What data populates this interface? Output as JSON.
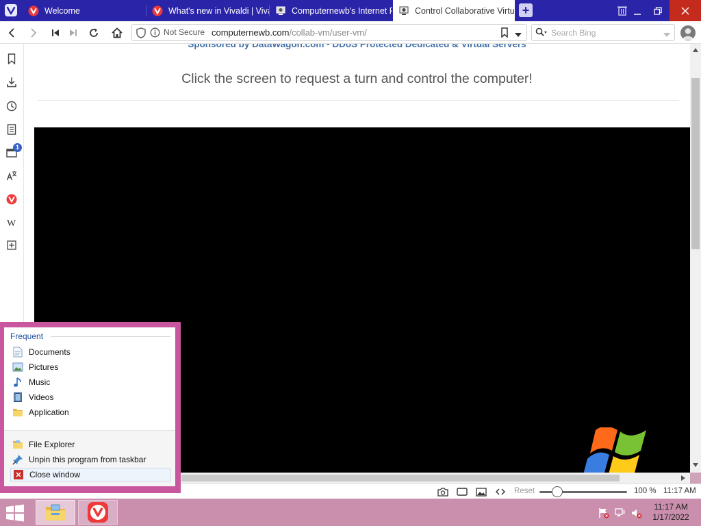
{
  "browser": {
    "tabs": [
      {
        "title": "Welcome",
        "icon": "vivaldi-icon",
        "active": false
      },
      {
        "title": "What's new in Vivaldi | Vival",
        "icon": "vivaldi-icon",
        "active": false
      },
      {
        "title": "Computernewb's Internet P",
        "icon": "computernewb-icon",
        "active": false
      },
      {
        "title": "Control Collaborative Virtu",
        "icon": "computernewb-icon",
        "active": true
      }
    ],
    "new_tab_label": "+",
    "address": {
      "security_label": "Not Secure",
      "host": "computernewb.com",
      "path": "/collab-vm/user-vm/"
    },
    "search": {
      "placeholder": "Search Bing"
    },
    "accent": "#2a24a8",
    "side_panel": {
      "downloads_badge": "1"
    }
  },
  "page": {
    "sponsor": "Sponsored by DataWagon.com - DDoS Protected Dedicated & Virtual Servers",
    "instruction": "Click the screen to request a turn and control the computer!"
  },
  "status_bar": {
    "reset_label": "Reset",
    "zoom": "100 %",
    "clock": "11:17 AM"
  },
  "jump_list": {
    "section_title": "Frequent",
    "frequent": [
      {
        "label": "Documents",
        "icon": "documents-icon"
      },
      {
        "label": "Pictures",
        "icon": "pictures-icon"
      },
      {
        "label": "Music",
        "icon": "music-icon"
      },
      {
        "label": "Videos",
        "icon": "videos-icon"
      },
      {
        "label": "Application",
        "icon": "folder-icon"
      }
    ],
    "tasks": [
      {
        "label": "File Explorer",
        "icon": "file-explorer-icon"
      },
      {
        "label": "Unpin this program from taskbar",
        "icon": "unpin-icon"
      },
      {
        "label": "Close window",
        "icon": "close-window-icon"
      }
    ]
  },
  "taskbar": {
    "time": "11:17 AM",
    "date": "1/17/2022",
    "color": "#c98fac"
  }
}
